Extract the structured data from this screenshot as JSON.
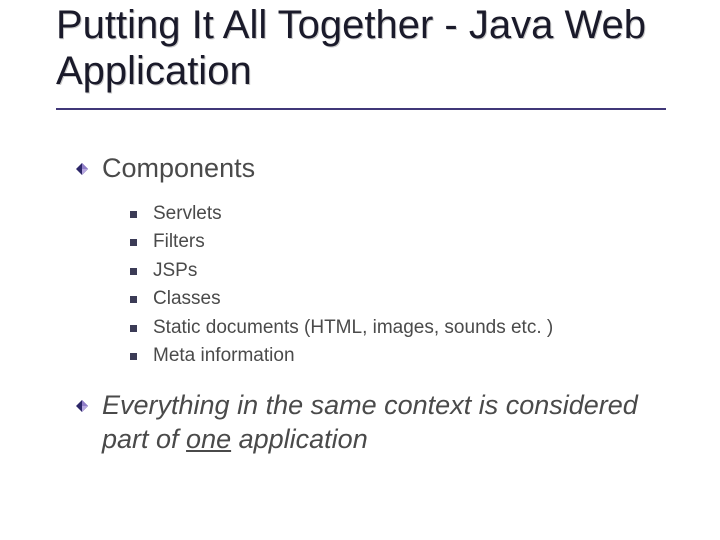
{
  "title": "Putting It All Together - Java Web Application",
  "bullets": {
    "first": {
      "label": "Components"
    },
    "sub": [
      {
        "label": "Servlets"
      },
      {
        "label": "Filters"
      },
      {
        "label": "JSPs"
      },
      {
        "label": "Classes"
      },
      {
        "label": "Static documents (HTML, images, sounds etc. )"
      },
      {
        "label": "Meta information"
      }
    ],
    "second": {
      "pre": "Everything in the same context is considered part of ",
      "emph": "one",
      "post": " application"
    }
  }
}
